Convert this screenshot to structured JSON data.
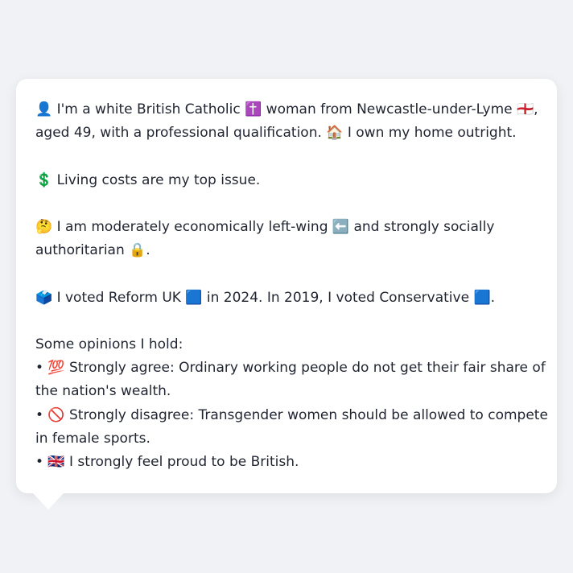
{
  "message": {
    "identity": {
      "line1": "👤 I'm a white British Catholic ✝️ woman from Newcastle-under-Lyme 🏴󠁧󠁢󠁥󠁮󠁧󠁿,",
      "line2": "aged 49, with a professional qualification. 🏠 I own my home outright."
    },
    "top_issue": "💲 Living costs are my top issue.",
    "ideology": {
      "line1": "🤔 I am moderately economically left-wing ⬅️ and strongly socially",
      "line2": "authoritarian 🔒."
    },
    "votes": "🗳️ I voted Reform UK 🟦 in 2024. In 2019, I voted Conservative 🟦.",
    "opinions_heading": "Some opinions I hold:",
    "opinions": [
      {
        "line1": "• 💯 Strongly agree: Ordinary working people do not get their fair share of",
        "line2": "the nation's wealth."
      },
      {
        "line1": "• 🚫 Strongly disagree: Transgender women should be allowed to compete",
        "line2": "in female sports."
      },
      {
        "line1": "• 🇬🇧 I strongly feel proud to be British.",
        "line2": ""
      }
    ]
  }
}
